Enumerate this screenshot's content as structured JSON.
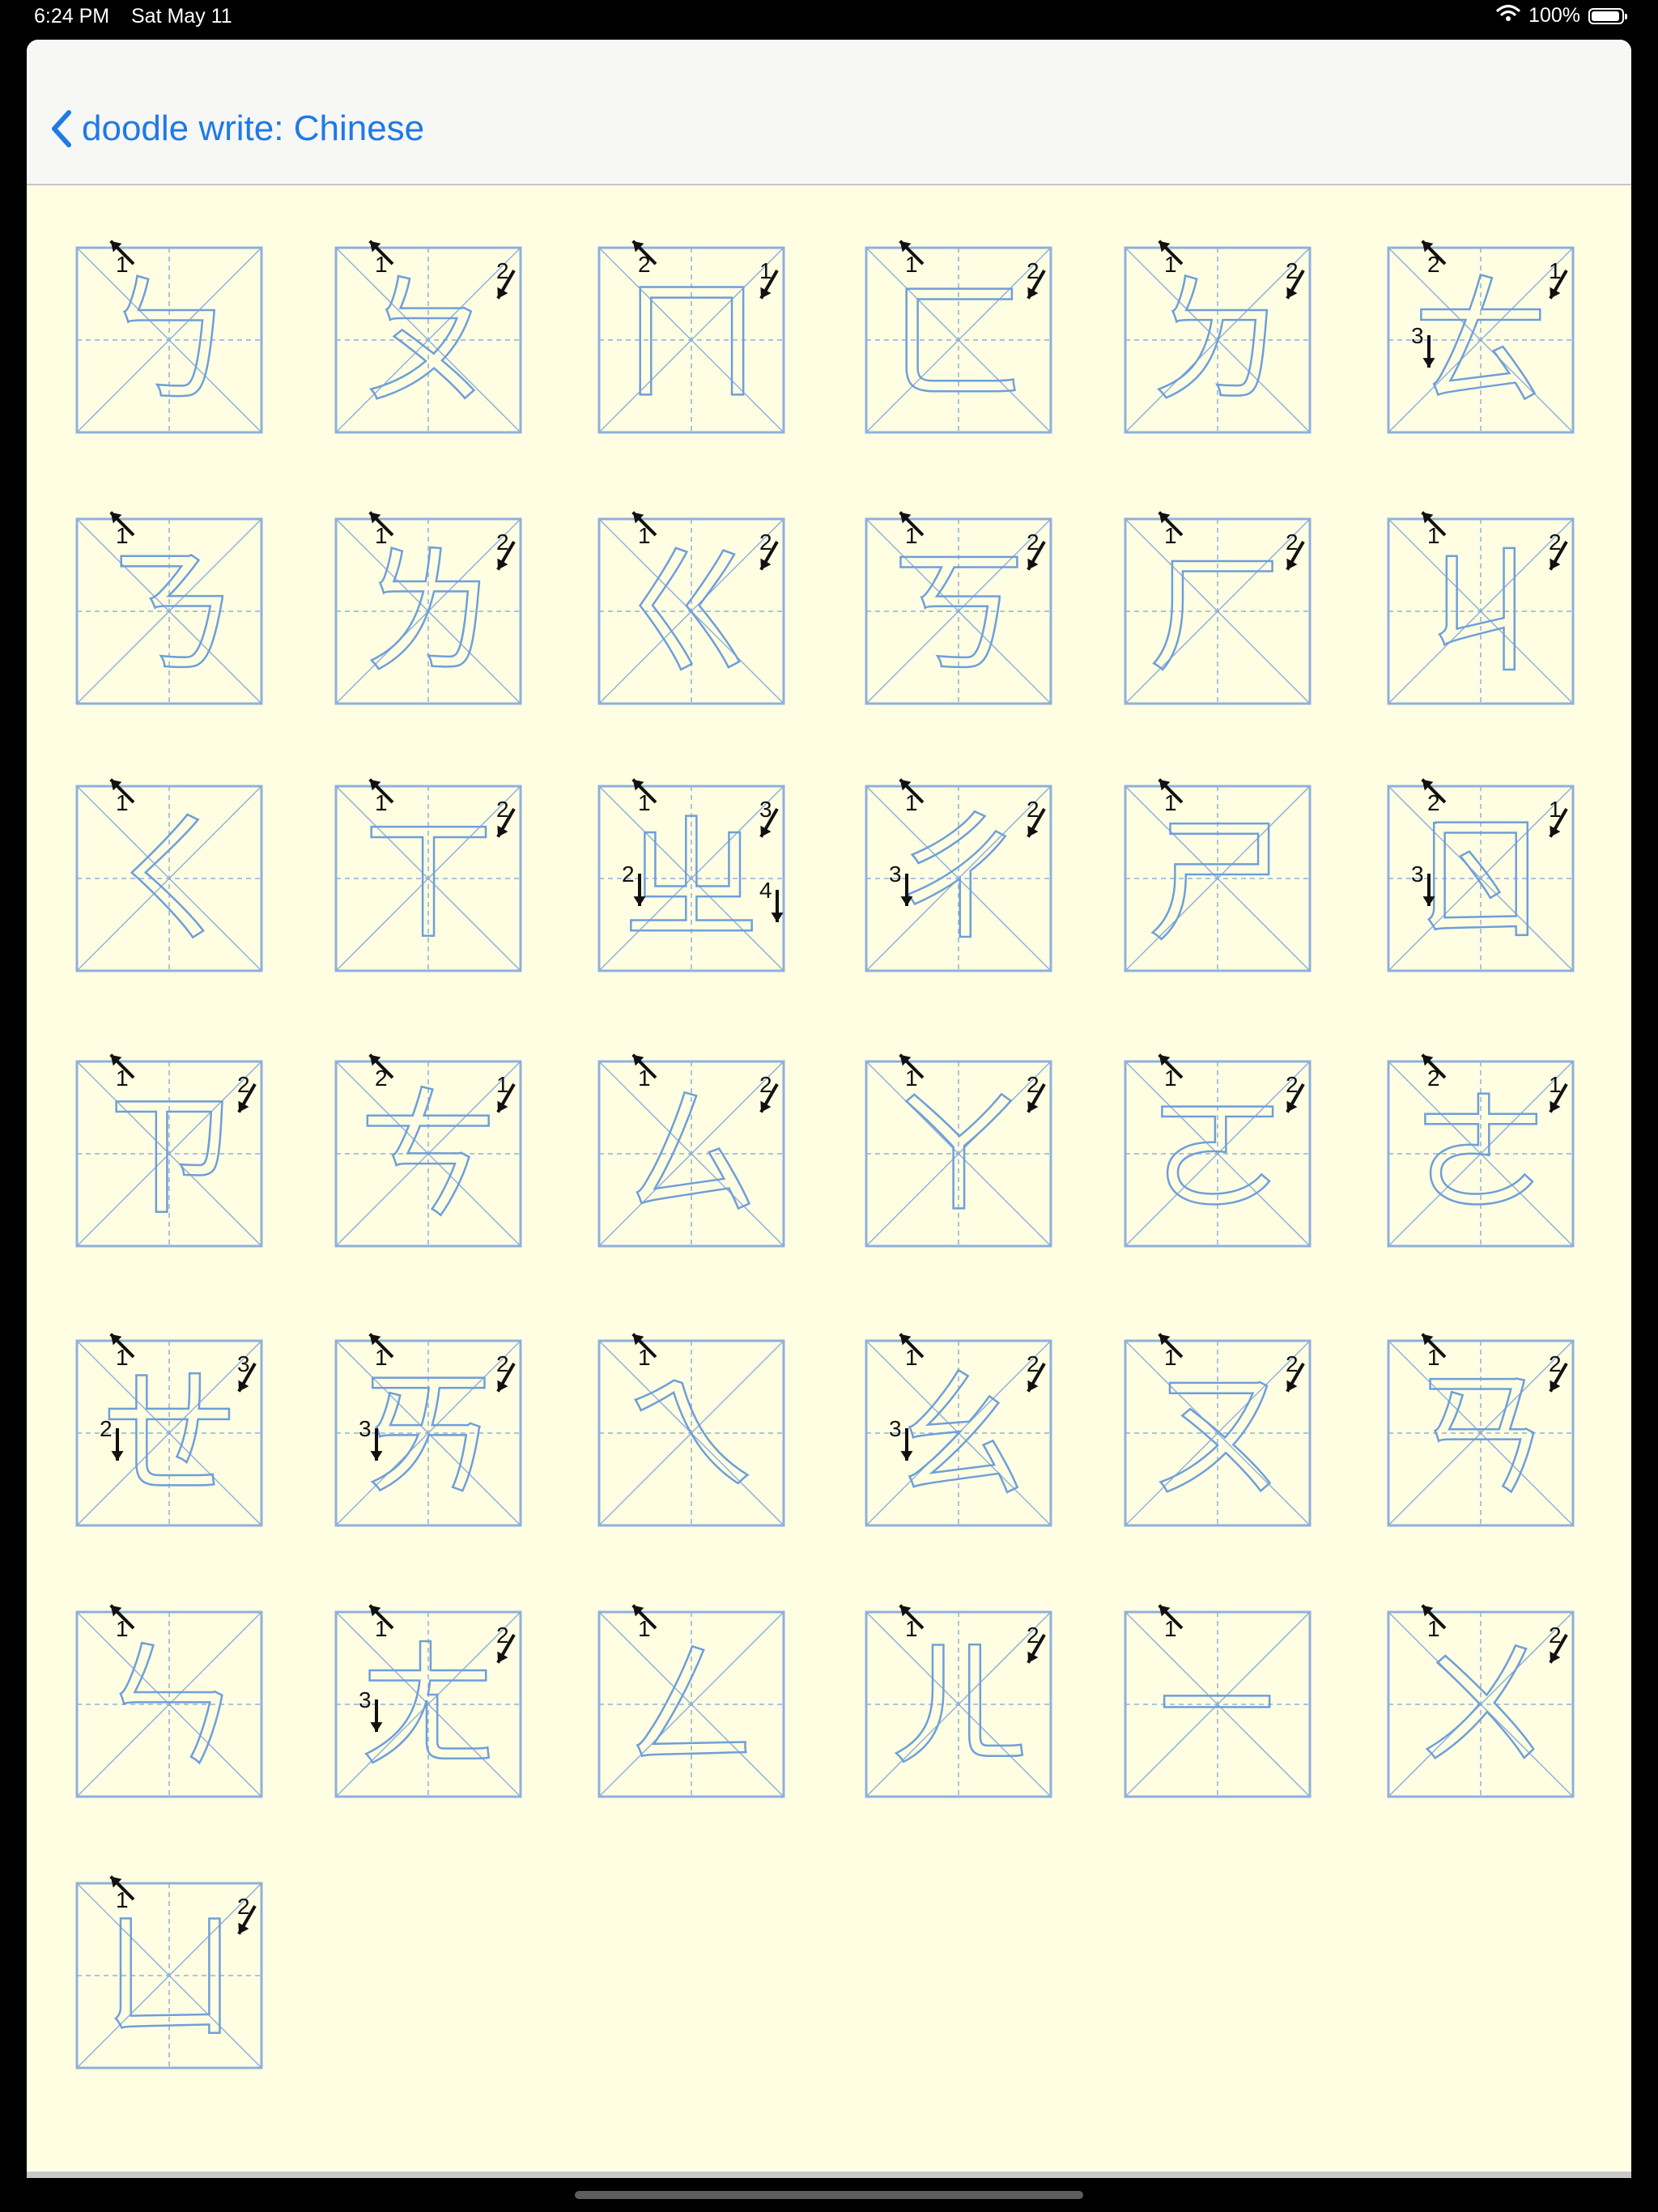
{
  "status_bar": {
    "time": "6:24 PM",
    "date": "Sat May 11",
    "battery": "100%",
    "icons": [
      "wifi-icon",
      "battery-icon"
    ]
  },
  "nav": {
    "back_label": "doodle write: Chinese",
    "back_icon": "chevron-left-icon"
  },
  "colors": {
    "accent": "#1f7ae6",
    "background": "#fffee3",
    "guide_lines": "#8fb0dc",
    "glyph_stroke": "#6f9fd8"
  },
  "characters": [
    {
      "char": "ㄅ",
      "stroke_labels": [
        "1"
      ]
    },
    {
      "char": "ㄆ",
      "stroke_labels": [
        "1",
        "2"
      ]
    },
    {
      "char": "ㄇ",
      "stroke_labels": [
        "2",
        "1"
      ]
    },
    {
      "char": "ㄈ",
      "stroke_labels": [
        "1",
        "2"
      ]
    },
    {
      "char": "ㄉ",
      "stroke_labels": [
        "1",
        "2"
      ]
    },
    {
      "char": "ㄊ",
      "stroke_labels": [
        "2",
        "1",
        "3"
      ]
    },
    {
      "char": "ㄋ",
      "stroke_labels": [
        "1"
      ]
    },
    {
      "char": "ㄌ",
      "stroke_labels": [
        "1",
        "2"
      ]
    },
    {
      "char": "ㄍ",
      "stroke_labels": [
        "1",
        "2"
      ]
    },
    {
      "char": "ㄎ",
      "stroke_labels": [
        "1",
        "2"
      ]
    },
    {
      "char": "ㄏ",
      "stroke_labels": [
        "1",
        "2"
      ]
    },
    {
      "char": "ㄐ",
      "stroke_labels": [
        "1",
        "2"
      ]
    },
    {
      "char": "ㄑ",
      "stroke_labels": [
        "1"
      ]
    },
    {
      "char": "ㄒ",
      "stroke_labels": [
        "1",
        "2"
      ]
    },
    {
      "char": "ㄓ",
      "stroke_labels": [
        "1",
        "3",
        "2",
        "4"
      ]
    },
    {
      "char": "ㄔ",
      "stroke_labels": [
        "1",
        "2",
        "3"
      ]
    },
    {
      "char": "ㄕ",
      "stroke_labels": [
        "1"
      ]
    },
    {
      "char": "ㄖ",
      "stroke_labels": [
        "2",
        "1",
        "3"
      ]
    },
    {
      "char": "ㄗ",
      "stroke_labels": [
        "1",
        "2"
      ]
    },
    {
      "char": "ㄘ",
      "stroke_labels": [
        "2",
        "1"
      ]
    },
    {
      "char": "ㄙ",
      "stroke_labels": [
        "1",
        "2"
      ]
    },
    {
      "char": "ㄚ",
      "stroke_labels": [
        "1",
        "2"
      ]
    },
    {
      "char": "ㄛ",
      "stroke_labels": [
        "1",
        "2"
      ]
    },
    {
      "char": "ㄜ",
      "stroke_labels": [
        "2",
        "1"
      ]
    },
    {
      "char": "ㄝ",
      "stroke_labels": [
        "1",
        "3",
        "2"
      ]
    },
    {
      "char": "ㄞ",
      "stroke_labels": [
        "1",
        "2",
        "3"
      ]
    },
    {
      "char": "ㄟ",
      "stroke_labels": [
        "1"
      ]
    },
    {
      "char": "ㄠ",
      "stroke_labels": [
        "1",
        "2",
        "3"
      ]
    },
    {
      "char": "ㄡ",
      "stroke_labels": [
        "1",
        "2"
      ]
    },
    {
      "char": "ㄢ",
      "stroke_labels": [
        "1",
        "2"
      ]
    },
    {
      "char": "ㄣ",
      "stroke_labels": [
        "1"
      ]
    },
    {
      "char": "ㄤ",
      "stroke_labels": [
        "1",
        "2",
        "3"
      ]
    },
    {
      "char": "ㄥ",
      "stroke_labels": [
        "1"
      ]
    },
    {
      "char": "ㄦ",
      "stroke_labels": [
        "1",
        "2"
      ]
    },
    {
      "char": "ㄧ",
      "stroke_labels": [
        "1"
      ]
    },
    {
      "char": "ㄨ",
      "stroke_labels": [
        "1",
        "2"
      ]
    },
    {
      "char": "ㄩ",
      "stroke_labels": [
        "1",
        "2"
      ]
    }
  ]
}
